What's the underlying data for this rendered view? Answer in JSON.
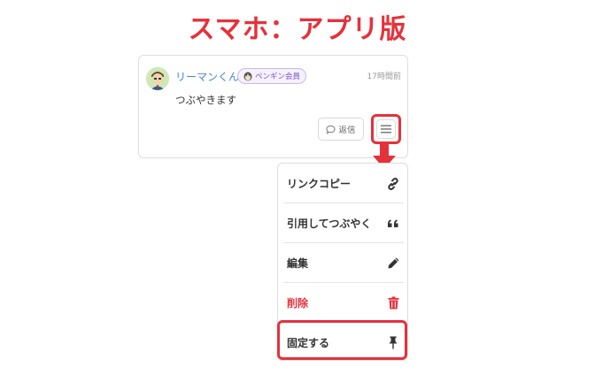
{
  "page": {
    "heading": "スマホ：アプリ版"
  },
  "post": {
    "username": "リーマンくん",
    "badge": "ペンギン会員",
    "timestamp": "17時間前",
    "body": "つぶやきます",
    "reply_label": "返信",
    "avatar_icon": "user-avatar",
    "menu_icon": "hamburger-menu-icon"
  },
  "menu": {
    "items": [
      {
        "label": "リンクコピー",
        "icon": "link-icon"
      },
      {
        "label": "引用してつぶやく",
        "icon": "quote-icon"
      },
      {
        "label": "編集",
        "icon": "pencil-icon"
      },
      {
        "label": "削除",
        "icon": "trash-icon",
        "color": "#e5313b"
      },
      {
        "label": "固定する",
        "icon": "pin-icon"
      }
    ]
  },
  "colors": {
    "accent": "#e5313b",
    "username": "#4a86d8",
    "badge": "#7a55d0"
  }
}
